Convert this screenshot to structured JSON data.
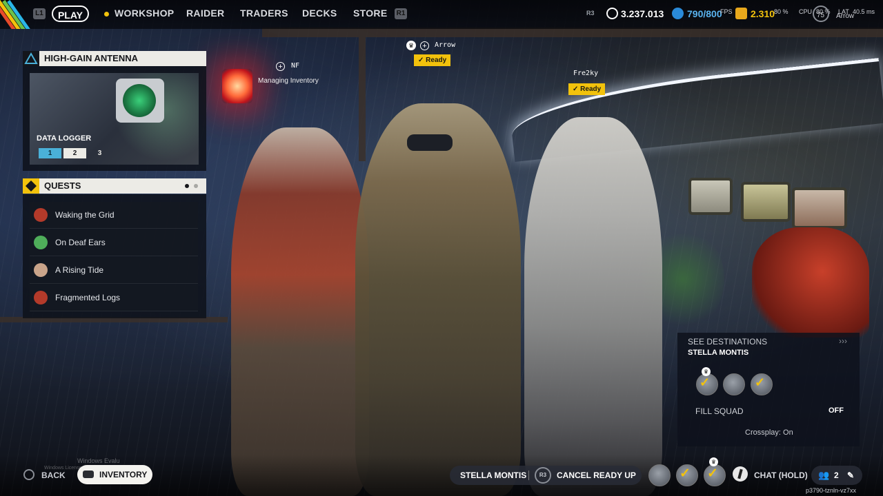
{
  "topbar": {
    "left_key": "L1",
    "right_key": "R1",
    "play_label": "PLAY",
    "nav": [
      "WORKSHOP",
      "RAIDER",
      "TRADERS",
      "DECKS",
      "STORE"
    ],
    "r3_key": "R3",
    "currency1": "3.237.013",
    "currency2": "790/800",
    "currency3": "2.310",
    "fps_label": "FPS",
    "fps_value": "75",
    "cpu_label": "CPU",
    "cpu_value": "80 %",
    "gpu_value": "80 %",
    "lat_label": "LAT",
    "lat_value": "40.5 ms",
    "user_name": "Arrow",
    "accent_color": "#f2c20c"
  },
  "antenna": {
    "title": "HIGH-GAIN ANTENNA",
    "item_label": "DATA LOGGER",
    "segments": [
      "1",
      "2",
      "3"
    ]
  },
  "quests": {
    "title": "QUESTS",
    "items": [
      {
        "label": "Waking the Grid",
        "color": "#b33a2a"
      },
      {
        "label": "On Deaf Ears",
        "color": "#4fae5a"
      },
      {
        "label": "A Rising Tide",
        "color": "#c9a48a"
      },
      {
        "label": "Fragmented Logs",
        "color": "#b33a2a"
      }
    ]
  },
  "players": {
    "p1_name": "Arrow",
    "p1_status": "Ready",
    "p2_name": "NF",
    "p2_status": "Managing Inventory",
    "p3_name": "Fre2ky",
    "p3_status": "Ready"
  },
  "destination": {
    "see_label": "SEE DESTINATIONS",
    "arrows": "›››",
    "name": "STELLA MONTIS",
    "fill_squad_label": "FILL SQUAD",
    "fill_squad_value": "OFF",
    "crossplay": "Crossplay: On"
  },
  "bottombar": {
    "back_label": "BACK",
    "inventory_label": "INVENTORY",
    "destination_label": "STELLA MONTIS",
    "r3_key": "R3",
    "cancel_label": "CANCEL READY UP",
    "chat_label": "CHAT (HOLD)",
    "party_count": "2",
    "session_id": "p3790-tznln-vz7xx",
    "watermark_1": "Windows Evalu",
    "watermark_2": "Windows License"
  }
}
